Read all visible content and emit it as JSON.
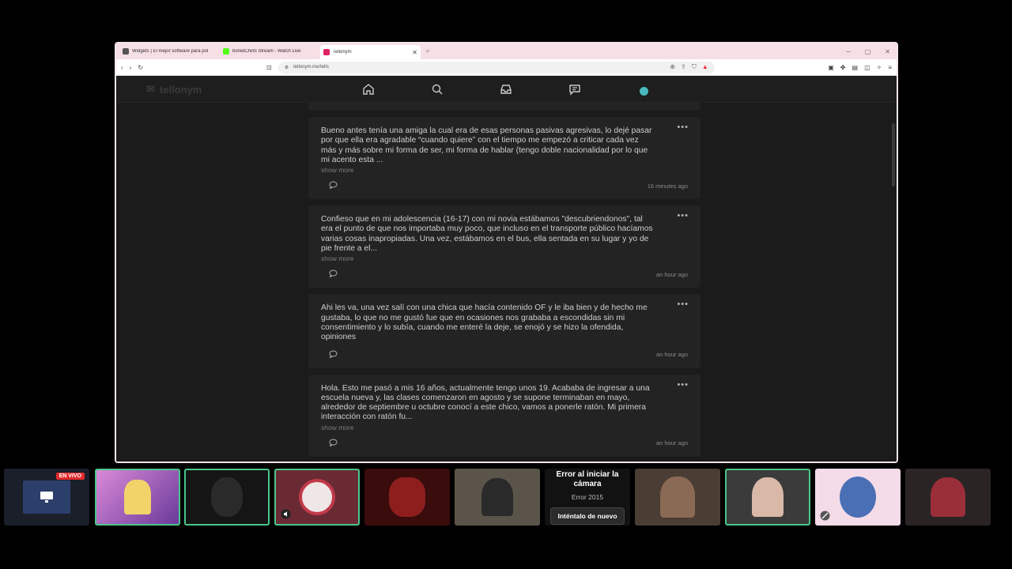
{
  "browser": {
    "tabs": [
      {
        "title": "Widgets | El mejor software para pol",
        "color": "#555555",
        "active": false
      },
      {
        "title": "boredChimi Stream - Watch Live",
        "color": "#53fc18",
        "active": false
      },
      {
        "title": "Tellonym",
        "color": "#e2215f",
        "active": true
      }
    ],
    "url": "tellonym.me/tells"
  },
  "app": {
    "brand": "tellonym"
  },
  "posts": [
    {
      "text": "Bueno antes tenía una amiga la cual era de esas personas pasivas agresivas, lo dejé pasar por que ella era agradable “cuando quiere” con el tiempo me empezó a criticar cada vez más y más sobre mi forma de ser, mi forma de hablar (tengo doble nacionalidad por lo que mi acento esta ...",
      "more": "show more",
      "time": "16 minutes ago"
    },
    {
      "text": "Confieso que en mi adolescencia (16-17) con mi novia estábamos \"descubriendonos\", tal era el punto de que nos importaba muy poco, que incluso en el transporte público hacíamos varias cosas inapropiadas. Una vez, estábamos en el bus, ella sentada en su lugar y yo de pie frente a el...",
      "more": "show more",
      "time": "an hour ago"
    },
    {
      "text": "Ahi les va, una vez salí con una chica que hacía contenido OF y le iba bien y de hecho me gustaba, lo que no me gustó fue que en ocasiones nos grababa a escondidas sin mi consentimiento y lo subía, cuando me enteré la deje, se enojó y se hizo la ofendida, opiniones",
      "more": "",
      "time": "an hour ago"
    },
    {
      "text": "Hola. Esto me pasó a mis 16 años, actualmente tengo unos 19. Acababa de ingresar a una escuela nueva y, las clases comenzaron en agosto y se supone terminaban en mayo, alrededor de septiembre u octubre conocí a este chico, vamos a ponerle ratón. Mi primera interacción con ratón fu...",
      "more": "show more",
      "time": "an hour ago"
    }
  ],
  "stream_strip": {
    "live_badge": "EN VIVO",
    "camera_error": {
      "title": "Error al iniciar la cámara",
      "code": "Error 2015",
      "retry": "Inténtalo de nuevo"
    }
  }
}
